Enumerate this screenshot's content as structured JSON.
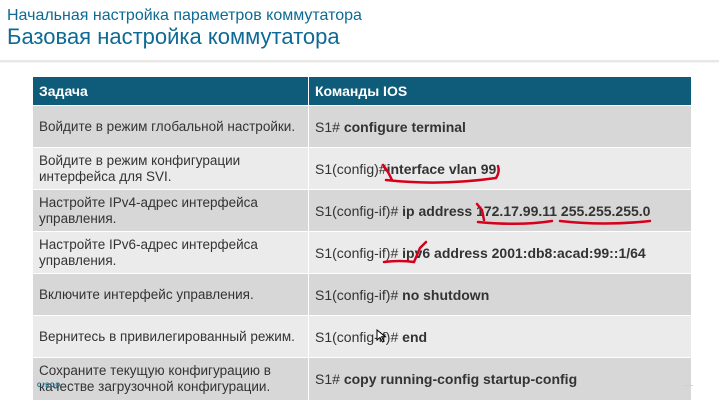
{
  "header": {
    "subtitle": "Начальная настройка параметров коммутатора",
    "title": "Базовая настройка коммутатора"
  },
  "table": {
    "col_task": "Задача",
    "col_cmd": "Команды IOS",
    "rows": [
      {
        "task": "Войдите в режим глобальной настройки.",
        "prompt": "S1#",
        "command": "configure terminal"
      },
      {
        "task": "Войдите в режим конфигурации интерфейса для SVI.",
        "prompt": "S1(config)#",
        "command": "interface vlan 99"
      },
      {
        "task": "Настройте IPv4-адрес интерфейса управления.",
        "prompt": "S1(config-if)#",
        "command": "ip address 172.17.99.11 255.255.255.0"
      },
      {
        "task": "Настройте IPv6-адрес интерфейса управления.",
        "prompt": "S1(config-if)#",
        "command": "ipv6 address 2001:db8:acad:99::1/64"
      },
      {
        "task": "Включите интерфейс управления.",
        "prompt": "S1(config-if)#",
        "command": "no shutdown"
      },
      {
        "task": "Вернитесь в привилегированный режим.",
        "prompt": "S1(config-if)#",
        "command": "end"
      },
      {
        "task": "Сохраните текущую конфигурацию в качестве загрузочной конфигурации.",
        "prompt": "S1#",
        "command": "copy running-config startup-config"
      }
    ]
  },
  "footer": {
    "logo_text": "CISCO"
  },
  "colors": {
    "accent": "#0e6a94",
    "header_bg": "#0e5c7a",
    "annotation_red": "#d6001c"
  }
}
